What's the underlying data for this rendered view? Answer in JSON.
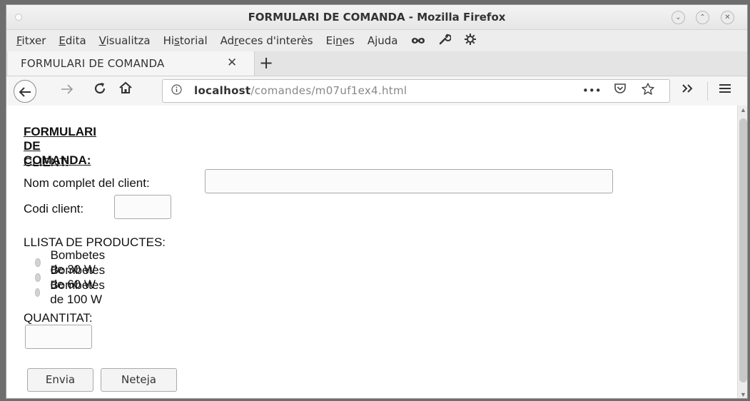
{
  "window": {
    "title": "FORMULARI DE COMANDA - Mozilla Firefox",
    "controls": {
      "minimize": "⌄",
      "maximize": "⌃",
      "close": "✕"
    }
  },
  "menubar": {
    "items": [
      {
        "prefix": "",
        "mnemonic": "F",
        "rest": "itxer"
      },
      {
        "prefix": "",
        "mnemonic": "E",
        "rest": "dita"
      },
      {
        "prefix": "",
        "mnemonic": "V",
        "rest": "isualitza"
      },
      {
        "prefix": "Hi",
        "mnemonic": "s",
        "rest": "torial"
      },
      {
        "prefix": "Ad",
        "mnemonic": "r",
        "rest": "eces d'interès"
      },
      {
        "prefix": "Ei",
        "mnemonic": "n",
        "rest": "es"
      },
      {
        "prefix": "A",
        "mnemonic": "j",
        "rest": "uda"
      }
    ],
    "icons": [
      "mask-icon",
      "wrench-icon",
      "gear-icon"
    ]
  },
  "tabs": [
    {
      "label": "FORMULARI DE COMANDA",
      "close": "✕"
    }
  ],
  "newtab_label": "+",
  "navbar": {
    "url_host": "localhost",
    "url_path": "/comandes/m07uf1ex4.html",
    "page_actions": "•••"
  },
  "page": {
    "heading": "FORMULARI DE COMANDA:",
    "client_section": "CLIENT:",
    "name_label": "Nom complet del client:",
    "name_value": "",
    "code_label": "Codi client:",
    "code_value": "",
    "products_section": "LLISTA DE PRODUCTES:",
    "products": [
      "Bombetes de 30 W",
      "Bombetes de 60 W",
      "Bombetes de 100 W"
    ],
    "quantity_section": "QUANTITAT:",
    "quantity_value": "",
    "submit_label": "Envia",
    "reset_label": "Neteja"
  },
  "colors": {
    "window_bg": "#f0f0f0",
    "page_bg": "#ffffff",
    "radio_fill": "#d3d3d3"
  }
}
